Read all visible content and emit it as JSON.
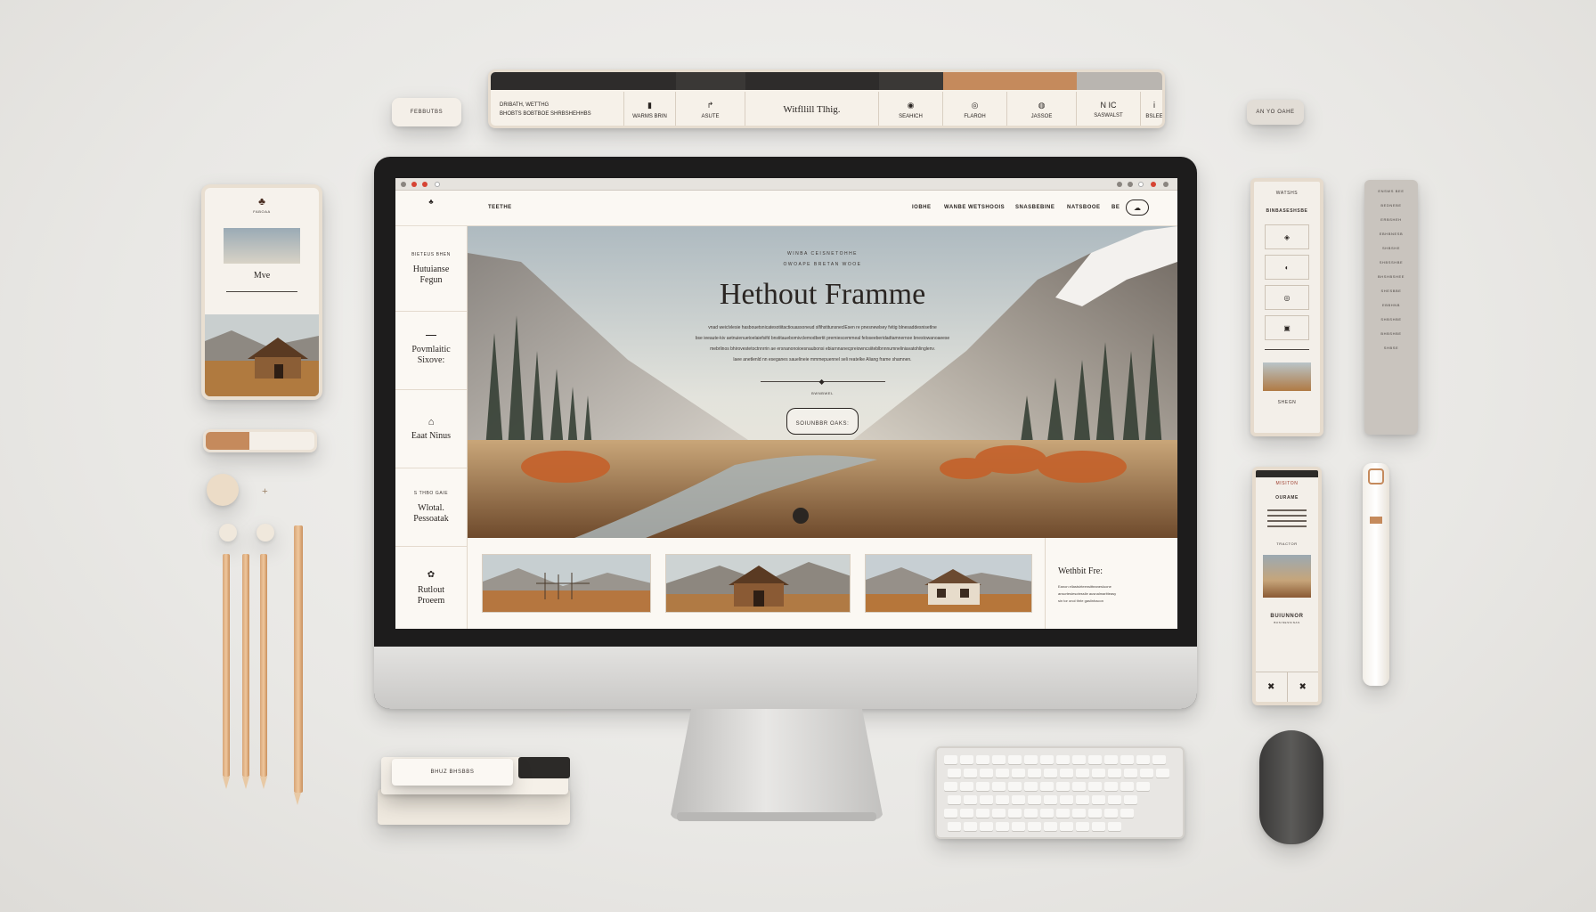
{
  "colors": {
    "accent": "#c58a5c",
    "dark": "#2b2a29",
    "cream": "#fbf8f3",
    "burnt_orange": "#c4612a"
  },
  "topbar": {
    "left_text_1": "DRIBATH, WETTHG",
    "left_text_2": "BHOBTS BOBTBOE SHRBSHEHHBS",
    "cells": [
      {
        "label": "WARMS BRIN",
        "icon": "bookmark-icon"
      },
      {
        "label": "ASUTE",
        "icon": "arrow-icon"
      },
      {
        "label": "Witfllill Tlhig.",
        "icon": ""
      },
      {
        "label": "SEAHICH",
        "icon": "pin-icon"
      },
      {
        "label": "FLAROH",
        "icon": "target-icon"
      },
      {
        "label": "JASSOE",
        "icon": "circle-icon"
      },
      {
        "label": "SASWALST",
        "icon": "nc-icon",
        "text": "N IC"
      },
      {
        "label": "Bslee",
        "icon": "info-icon"
      }
    ]
  },
  "pill_left": "FEBBUTBS",
  "pill_right": "AN YO OAHE",
  "browser": {
    "nav": {
      "brand": "TEETHE",
      "links": [
        "IOBHE",
        "WANBE WETSHOOIS",
        "SNASBEBINE",
        "NATSBOOE",
        "BE"
      ]
    },
    "left_menu": [
      {
        "kicker": "BIETEUS BHEN",
        "title": "Hutuianse Fegun"
      },
      {
        "kicker": "",
        "title": "Povmlaitic Sixove:"
      },
      {
        "kicker": "",
        "title": "Eaat Ninus"
      },
      {
        "kicker": "S THBO GAIE",
        "title": "Wlotal. Pessoatak"
      },
      {
        "kicker": "",
        "title": "Rutlout Proeem"
      }
    ],
    "hero": {
      "kicker_1": "WINBA CEISNETOHHE",
      "kicker_2": "OWOAPE BRETAN WOOE",
      "title": "Hethout Framme",
      "body_1": "vnad weiclvlesie hasbouetsnicatesotiitactiouassoneud slfihstitunsneclEsen re pnesnewlsey fvitig blnesaddesnisetlne",
      "body_2": "bse ieeaute-kiv aetnuienuetoelaiefsifd bnstitauebomivclemodbertit premiescemmeal feloseeberidadtamnernoe bnestowanoaeese",
      "body_3": "mebrlinos bhirovestetoctnnrrin ae ersnanonoioesnaubonsi ebiarnnanecpreiowncsiiteblbnnnumneliniavatohlinglenv.",
      "body_4": "laee anetlenld nn eseganes sauelineie mmmepuennel seli reatelke Aliang frame shamnen.",
      "divider_label": "BWNBWEL",
      "cta": "SOIUNBBR OAKS:"
    },
    "feature": {
      "title": "Wethbit Fre:",
      "body_1": "Eanon ellastsirteensitteanesluone",
      "body_2": "anscrtesiesotesslie ausnalmaritteasy",
      "body_3": "sin tor onol thrle gaslinhacon"
    }
  },
  "phone_left": {
    "logo": "FABOAA",
    "caption": "Mve"
  },
  "panel_r1": {
    "title": "WATSHS",
    "subtitle": "BINBASESHSBE",
    "footer": "SHEGN"
  },
  "panel_r2": {
    "items": [
      "ENSWS BEE",
      "BEDNEBE",
      "ERBSHEH",
      "EBHBNESB",
      "SHBSHE",
      "SHBSSHBE",
      "BHSHBSHEE",
      "SHESBBE",
      "EBBHNB",
      "SHBSHBE",
      "BHBSHBE",
      "SHBSE"
    ]
  },
  "panel_r3": {
    "title_1": "MISITON",
    "title_2": "Ourame",
    "label": "TRACTOR",
    "footer": "Buiunnor",
    "footer_sub": "BUSINESSINAS"
  },
  "notepad": {
    "label": "BHUZ BHSBBS"
  }
}
